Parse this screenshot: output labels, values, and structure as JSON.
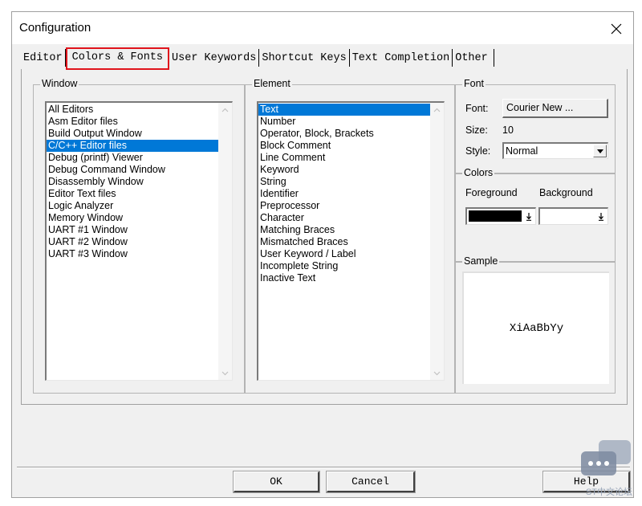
{
  "window": {
    "title": "Configuration"
  },
  "tabs": [
    {
      "label": "Editor"
    },
    {
      "label": "Colors & Fonts"
    },
    {
      "label": "User Keywords"
    },
    {
      "label": "Shortcut Keys"
    },
    {
      "label": "Text Completion"
    },
    {
      "label": "Other"
    }
  ],
  "window_group": {
    "label": "Window",
    "items": [
      "All Editors",
      "Asm Editor files",
      "Build Output Window",
      "C/C++ Editor files",
      "Debug (printf) Viewer",
      "Debug Command Window",
      "Disassembly Window",
      "Editor Text files",
      "Logic Analyzer",
      "Memory Window",
      "UART #1 Window",
      "UART #2 Window",
      "UART #3 Window"
    ],
    "selected_index": 3
  },
  "element_group": {
    "label": "Element",
    "items": [
      "Text",
      "Number",
      "Operator, Block, Brackets",
      "Block Comment",
      "Line Comment",
      "Keyword",
      "String",
      "Identifier",
      "Preprocessor",
      "Character",
      "Matching Braces",
      "Mismatched Braces",
      "User Keyword / Label",
      "Incomplete String",
      "Inactive Text"
    ],
    "selected_index": 0
  },
  "font_group": {
    "label": "Font",
    "font_label": "Font:",
    "font_button": "Courier New ...",
    "size_label": "Size:",
    "size_value": "10",
    "style_label": "Style:",
    "style_value": "Normal"
  },
  "colors_group": {
    "label": "Colors",
    "foreground_label": "Foreground",
    "background_label": "Background",
    "foreground_color": "#000000",
    "background_color": "#ffffff"
  },
  "sample_group": {
    "label": "Sample",
    "sample_text": "XiAaBbYy"
  },
  "buttons": {
    "ok": "OK",
    "cancel": "Cancel",
    "help": "Help"
  },
  "watermark": {
    "text": "ST中文论坛"
  },
  "accent_color": "#0078d7",
  "highlight_border_color": "#e0141c"
}
